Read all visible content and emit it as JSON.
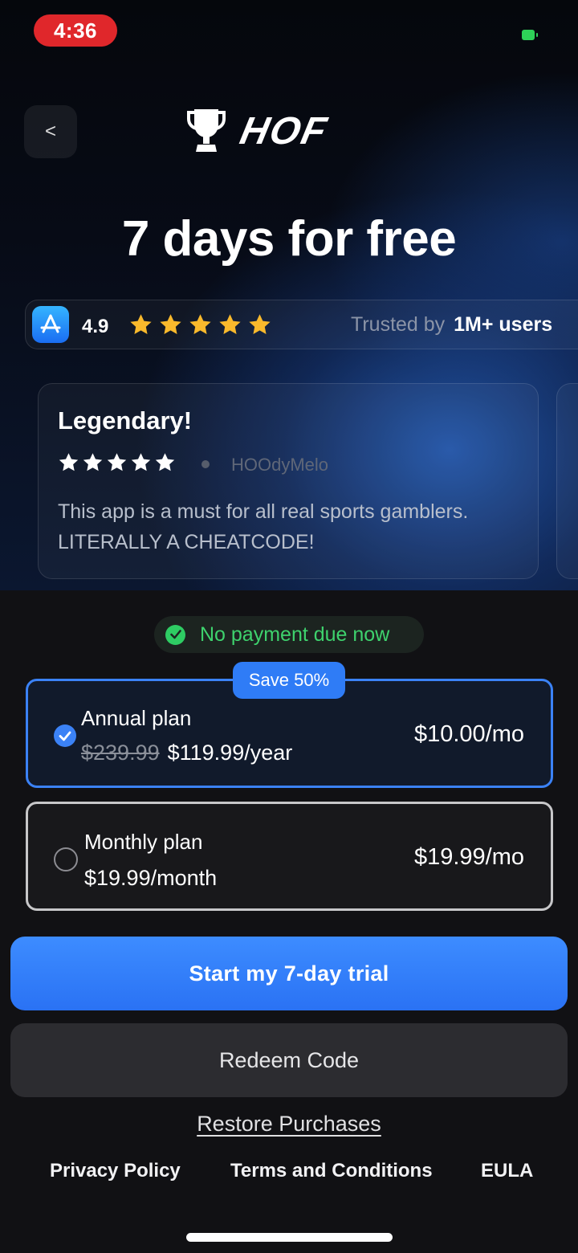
{
  "status_bar": {
    "time": "4:36",
    "battery_color": "#2ed158"
  },
  "header": {
    "back_label": "<",
    "logo_text": "HOF"
  },
  "headline": "7 days for free",
  "rating": {
    "value": "4.9",
    "stars": 5,
    "trusted_prefix": "Trusted by",
    "trusted_count": "1M+ users"
  },
  "review": {
    "title": "Legendary!",
    "stars": 5,
    "author": "HOOdyMelo",
    "body": "This app is a must for all real sports gamblers. LITERALLY A CHEATCODE!"
  },
  "no_payment": "No payment due now",
  "plans": {
    "save_badge": "Save 50%",
    "annual": {
      "name": "Annual plan",
      "old_price": "$239.99",
      "price": "$119.99/year",
      "monthly_equiv": "$10.00/mo",
      "selected": true
    },
    "monthly": {
      "name": "Monthly plan",
      "price": "$19.99/month",
      "monthly_equiv": "$19.99/mo",
      "selected": false
    }
  },
  "buttons": {
    "start_trial": "Start my 7-day trial",
    "redeem": "Redeem Code",
    "restore": "Restore Purchases"
  },
  "footer": {
    "privacy": "Privacy Policy",
    "terms": "Terms and Conditions",
    "eula": "EULA"
  },
  "colors": {
    "accent": "#3b82f6",
    "star": "#f9b92c",
    "success": "#2ecc63"
  }
}
